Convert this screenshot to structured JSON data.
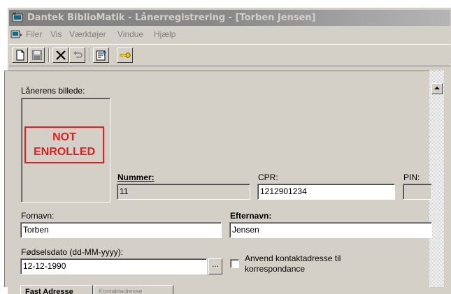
{
  "window": {
    "title": "Dantek BiblioMatik - Lånerregistrering - [Torben Jensen]"
  },
  "menu": {
    "items": [
      "Filer",
      "Vis",
      "Værktøjer",
      "Vindue",
      "Hjælp"
    ]
  },
  "toolbar": {
    "buttons": [
      "new-document-icon",
      "save-icon",
      "delete-icon",
      "undo-icon",
      "properties-icon",
      "key-icon"
    ]
  },
  "form": {
    "photo_label": "Lånerens billede:",
    "photo_status": "NOT ENROLLED",
    "nummer_label": "Nummer:",
    "nummer_value": "11",
    "cpr_label": "CPR:",
    "cpr_value": "1212901234",
    "pin_label": "PIN:",
    "pin_value": "",
    "fornavn_label": "Fornavn:",
    "fornavn_value": "Torben",
    "efternavn_label": "Efternavn:",
    "efternavn_value": "Jensen",
    "birthdate_label": "Fødselsdato (dd-MM-yyyy):",
    "birthdate_value": "12-12-1990",
    "dots_label": "...",
    "contact_checkbox_line1": "Anvend kontaktadresse til",
    "contact_checkbox_line2": "korrespondance",
    "contact_checkbox_checked": false
  },
  "tabs": [
    "Fast Adresse",
    "Kontaktadresse"
  ],
  "colors": {
    "window_bg": "#d4d0c8",
    "status_red": "#e02020",
    "title_gray": "#7f7f7f"
  }
}
